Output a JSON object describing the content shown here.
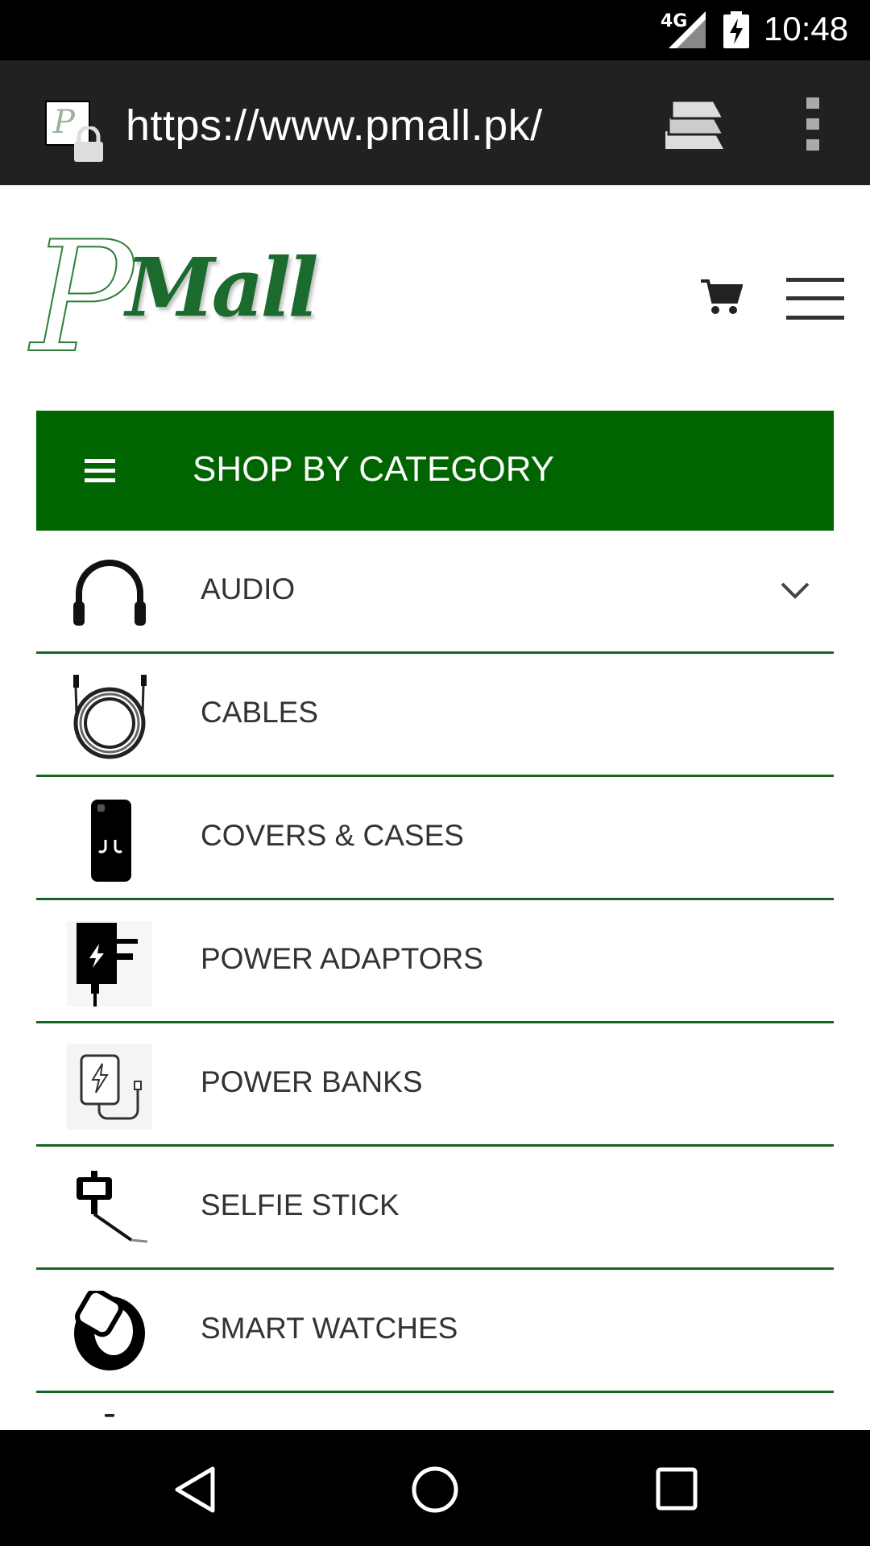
{
  "status_bar": {
    "network": "4G",
    "time": "10:48"
  },
  "browser": {
    "url": "https://www.pmall.pk/"
  },
  "site": {
    "logo_p": "P",
    "logo_mall": "Mall"
  },
  "category_menu": {
    "title": "SHOP BY CATEGORY",
    "items": [
      {
        "label": "AUDIO",
        "icon": "headphones-icon",
        "expandable": true
      },
      {
        "label": "CABLES",
        "icon": "cable-icon"
      },
      {
        "label": "COVERS & CASES",
        "icon": "phone-case-icon"
      },
      {
        "label": "POWER ADAPTORS",
        "icon": "power-adaptor-icon"
      },
      {
        "label": "POWER BANKS",
        "icon": "power-bank-icon"
      },
      {
        "label": "SELFIE STICK",
        "icon": "selfie-stick-icon"
      },
      {
        "label": "SMART WATCHES",
        "icon": "smart-watch-icon"
      }
    ]
  },
  "colors": {
    "brand_green": "#006400",
    "divider_green": "#14661f"
  }
}
